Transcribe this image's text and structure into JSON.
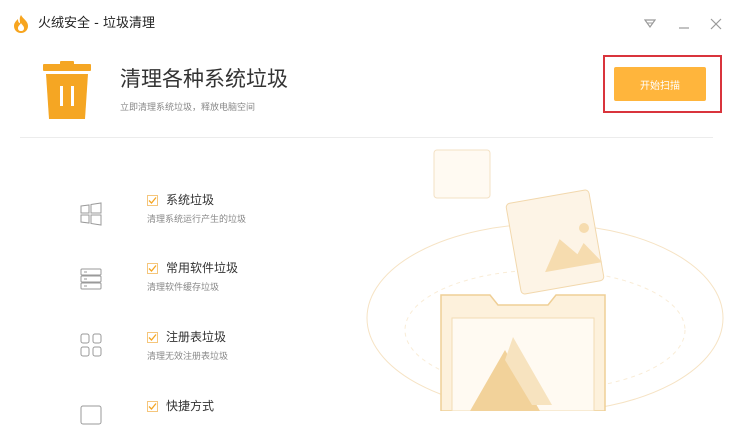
{
  "window": {
    "title": "火绒安全 - 垃圾清理",
    "icons": [
      "fire-logo-icon",
      "menu-dropdown-icon",
      "minimize-icon",
      "close-icon"
    ]
  },
  "header": {
    "title": "清理各种系统垃圾",
    "subtitle": "立即清理系统垃圾，释放电脑空间",
    "icon": "trash-icon",
    "scan_button_label": "开始扫描"
  },
  "items": [
    {
      "name": "系统垃圾",
      "desc": "清理系统运行产生的垃圾",
      "checked": true,
      "icon": "windows-icon"
    },
    {
      "name": "常用软件垃圾",
      "desc": "清理软件缓存垃圾",
      "checked": true,
      "icon": "stack-icon"
    },
    {
      "name": "注册表垃圾",
      "desc": "清理无效注册表垃圾",
      "checked": true,
      "icon": "registry-grid-icon"
    },
    {
      "name": "快捷方式",
      "desc": "",
      "checked": true,
      "icon": "shortcut-icon"
    }
  ],
  "colors": {
    "accent": "#ffb53c",
    "highlight_border": "#d9343c",
    "checkbox_border": "#f5c67c",
    "icon_gray": "#9a9a9a"
  }
}
